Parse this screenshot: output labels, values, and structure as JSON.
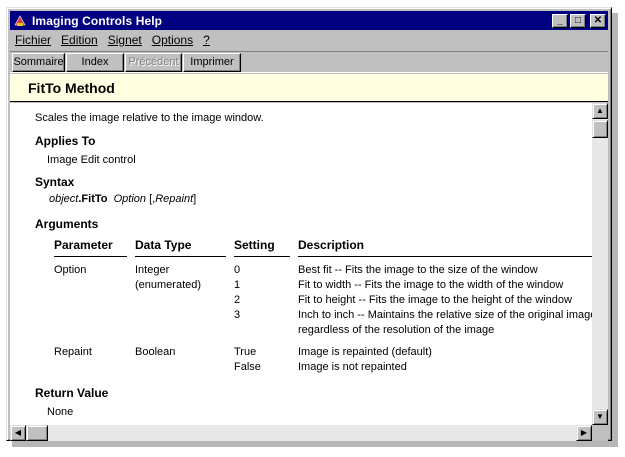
{
  "window": {
    "title": "Imaging Controls Help"
  },
  "caption_buttons": {
    "minimize": "_",
    "maximize": "□",
    "close": "✕"
  },
  "menu": [
    {
      "label": "Fichier"
    },
    {
      "label": "Edition"
    },
    {
      "label": "Signet"
    },
    {
      "label": "Options"
    },
    {
      "label": "?"
    }
  ],
  "toolbar": {
    "sommaire": "Sommaire",
    "index": "Index",
    "precedent": "Précédent",
    "imprimer": "Imprimer"
  },
  "topic": {
    "title": "FitTo Method",
    "summary": "Scales the image relative to the image window.",
    "applies_to_heading": "Applies To",
    "applies_to": "Image Edit control",
    "syntax_heading": "Syntax",
    "syntax": {
      "object": "object",
      "method": ".FitTo",
      "option": "Option",
      "rest": "[,",
      "repaint": "Repaint",
      "close": "]"
    },
    "arguments_heading": "Arguments",
    "columns": [
      "Parameter",
      "Data Type",
      "Setting",
      "Description"
    ],
    "rows": [
      {
        "parameter": "Option",
        "datatype": [
          "Integer",
          "(enumerated)"
        ],
        "settings": [
          "0",
          "1",
          "2",
          "3"
        ],
        "descriptions": [
          "Best fit -- Fits the image to the size of the window",
          "Fit to width -- Fits the image to the width of the window",
          "Fit to height -- Fits the image to the height of the window",
          "Inch to inch -- Maintains the relative size of the original image",
          "regardless of the resolution of the image"
        ]
      },
      {
        "parameter": "Repaint",
        "datatype": [
          "Boolean"
        ],
        "settings": [
          "True",
          "False"
        ],
        "descriptions": [
          "Image is repainted (default)",
          "Image is not repainted"
        ]
      }
    ],
    "return_heading": "Return Value",
    "return_value": "None"
  }
}
